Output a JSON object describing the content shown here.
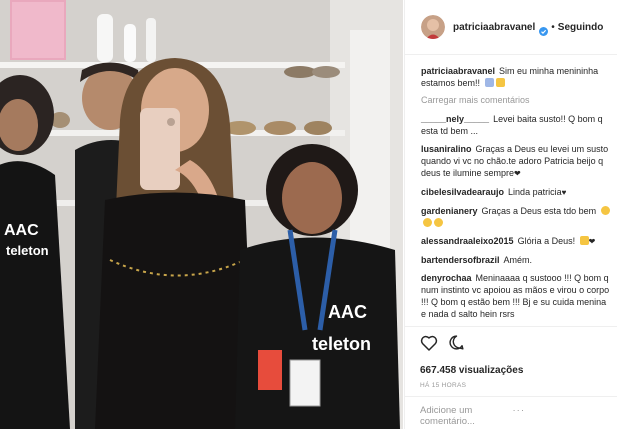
{
  "header": {
    "username": "patriciaabravanel",
    "separator": "•",
    "follow_state": "Seguindo"
  },
  "comments": [
    {
      "user": "patriciaabravanel",
      "text": "Sim eu minha menininha estamos bem!!"
    },
    {
      "user": "",
      "text": "Carregar mais comentários"
    },
    {
      "user": "_____nely_____",
      "text": "Levei baita susto!! Q bom q esta td bem ..."
    },
    {
      "user": "lusanirali​no",
      "text": "Graças a Deus eu levei um susto quando vi vc no chão.te adoro Patricia beijo q deus te ilumine sempre"
    },
    {
      "user": "cibelesilvadearaujo",
      "text": "Linda patricia"
    },
    {
      "user": "gardenianery",
      "text": "Graças a Deus esta tdo bem"
    },
    {
      "user": "alessandraaleixo2015",
      "text": "Glória a Deus!"
    },
    {
      "user": "bartendersofbrazil",
      "text": "Amém."
    },
    {
      "user": "denyrochaa",
      "text": "Meninaaaa q sustooo !!! Q bom q num instinto vc apoiou as mãos e virou o corpo !!! Q bom q estão bem !!! Bj e su cuida menina e nada d salto hein rsrs"
    }
  ],
  "engagement": {
    "views": "667.458 visualizações",
    "time_ago": "HÁ 15 HORAS"
  },
  "add_comment": {
    "placeholder": "Adicione um comentário...",
    "more": "···"
  },
  "media": {
    "shirt_text_left": "AAC",
    "shirt_text_left2": "teleton",
    "shirt_text_right": "AAC",
    "shirt_text_right2": "teleton"
  },
  "colors": {
    "verified": "#3897f0",
    "link_text": "#262626",
    "muted": "#999999"
  },
  "icons": [
    "heart-icon",
    "comment-icon",
    "verified-icon",
    "more-icon"
  ]
}
